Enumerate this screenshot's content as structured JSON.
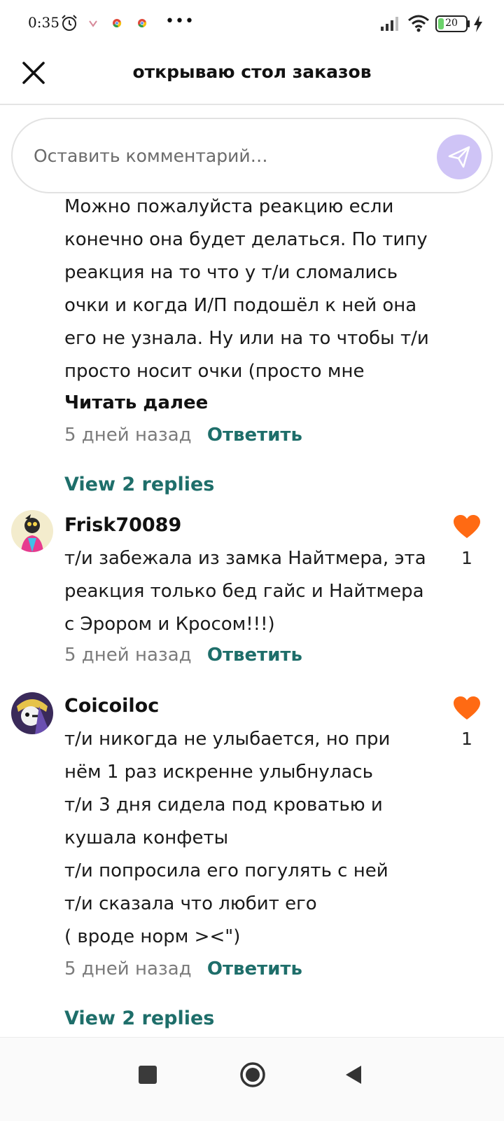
{
  "status_bar": {
    "time": "0:35",
    "battery_level": "20",
    "battery_fraction": 0.2,
    "icons": [
      "alarm-icon",
      "app-notification-icon",
      "chrome-icon",
      "chrome-icon",
      "more-dots-icon",
      "signal-icon",
      "wifi-icon",
      "battery-icon",
      "charging-icon"
    ],
    "more_dots": "•••"
  },
  "header": {
    "title": "открываю стол заказов",
    "close_icon": "close-icon"
  },
  "comment_box": {
    "placeholder": "Оставить комментарий…",
    "send_icon": "send-icon",
    "send_color": "#cfc4f6"
  },
  "colors": {
    "accent_teal": "#1e6e6a",
    "heart_orange": "#ff6a13",
    "meta_gray": "#7b7b7b"
  },
  "comments": [
    {
      "lines": [
        "Можно пожалуйста реакцию если",
        "конечно она будет делаться. По типу",
        "реакция на то что у т/и сломались",
        "очки и когда И/П подошёл к ней она",
        "его не узнала. Ну или на то чтобы т/и",
        "просто носит очки (просто мне"
      ],
      "read_more": "Читать далее",
      "time": "5 дней назад",
      "reply": "Ответить",
      "view_replies": "View 2 replies"
    },
    {
      "username": "Frisk70089",
      "lines": [
        "т/и забежала из замка Найтмера, эта",
        "реакция только бед гайс и Найтмера",
        "с Эрором и Кросом!!!)"
      ],
      "time": "5 дней назад",
      "reply": "Ответить",
      "likes": "1"
    },
    {
      "username": "Coicoiloc",
      "lines": [
        "т/и никогда не улыбается, но при",
        "нём 1 раз искренне улыбнулась",
        "т/и 3 дня сидела под кроватью и",
        "кушала конфеты",
        "т/и попросила его погулять с ней",
        "т/и сказала что любит его",
        "( вроде норм ><\")"
      ],
      "time": "5 дней назад",
      "reply": "Ответить",
      "likes": "1",
      "view_replies": "View 2 replies"
    }
  ],
  "nav_bar": {
    "icons": [
      "recents-square-icon",
      "home-circle-icon",
      "back-triangle-icon"
    ]
  }
}
